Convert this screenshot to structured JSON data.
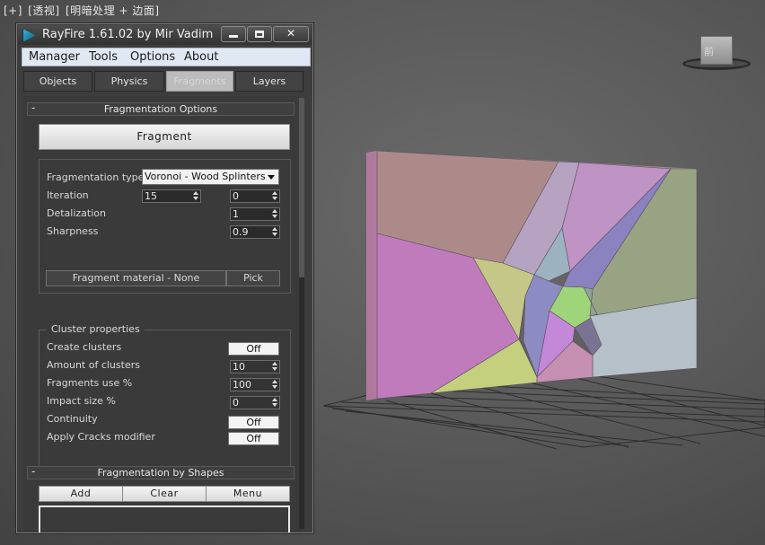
{
  "viewport": {
    "label_parts": [
      "[+]",
      "[透视]",
      "[明暗处理 + 边面]"
    ],
    "viewcube_label": "前"
  },
  "window": {
    "title": "RayFire 1.61.02  by Mir Vadim",
    "minimize_label": "",
    "maximize_label": "",
    "close_label": "✕"
  },
  "menu": [
    "Manager",
    "Tools",
    "Options",
    "About"
  ],
  "tabs": [
    {
      "label": "Objects",
      "active": false
    },
    {
      "label": "Physics",
      "active": false
    },
    {
      "label": "Fragments",
      "active": true
    },
    {
      "label": "Layers",
      "active": false
    }
  ],
  "fragmentation_options": {
    "collapse_symbol": "-",
    "title": "Fragmentation Options",
    "fragment_button": "Fragment",
    "type_label": "Fragmentation type",
    "type_value": "Voronoi - Wood Splinters",
    "iteration_label": "Iteration",
    "iteration_value": "15",
    "iteration_value2": "0",
    "detalization_label": "Detalization",
    "detalization_value": "1",
    "sharpness_label": "Sharpness",
    "sharpness_value": "0.9",
    "material_button": "Fragment material - None",
    "pick_button": "Pick"
  },
  "cluster_properties": {
    "title": "Cluster properties",
    "create_clusters_label": "Create clusters",
    "create_clusters_value": "Off",
    "amount_label": "Amount of clusters",
    "amount_value": "10",
    "fragments_use_label": "Fragments use %",
    "fragments_use_value": "100",
    "impact_size_label": "Impact size %",
    "impact_size_value": "0",
    "continuity_label": "Continuity",
    "continuity_value": "Off",
    "apply_cracks_label": "Apply Cracks modifier",
    "apply_cracks_value": "Off"
  },
  "fragmentation_by_shapes": {
    "collapse_symbol": "-",
    "title": "Fragmentation by Shapes",
    "add_button": "Add",
    "clear_button": "Clear",
    "menu_button": "Menu"
  },
  "colors": {
    "panel_bg": "#3a3a3a",
    "menubar_bg": "#dfe8f3",
    "active_tab": "#bcbcbc",
    "button_face": "#f0f0f0"
  }
}
